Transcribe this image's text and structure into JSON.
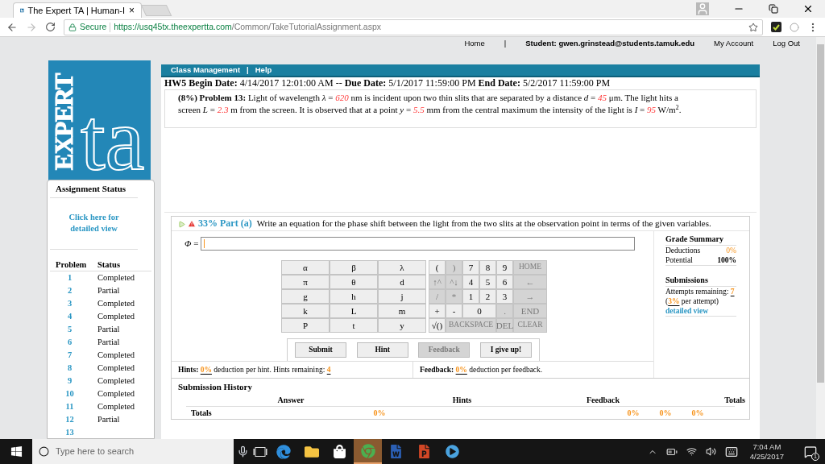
{
  "browser": {
    "tab": {
      "title": "The Expert TA | Human-I",
      "close": "×"
    },
    "address": {
      "secure": "Secure",
      "url_host": "https://usq45tx.theexpertta.com",
      "url_path": "/Common/TakeTutorialAssignment.aspx"
    }
  },
  "top_nav": [
    {
      "kind": "link",
      "text": "Home"
    },
    {
      "kind": "separator",
      "text": "|"
    },
    {
      "kind": "user",
      "text": "Student: gwen.grinstead@students.tamuk.edu"
    },
    {
      "kind": "link",
      "text": "My Account"
    },
    {
      "kind": "link",
      "text": "Log Out"
    }
  ],
  "logo": {
    "word": "EXPERT",
    "mark": "ta"
  },
  "assignment_status": {
    "title": "Assignment Status",
    "detail_link": "Click here for detailed view",
    "columns": [
      "Problem",
      "Status"
    ],
    "rows": [
      {
        "problem": "1",
        "status": "Completed"
      },
      {
        "problem": "2",
        "status": "Partial"
      },
      {
        "problem": "3",
        "status": "Completed"
      },
      {
        "problem": "4",
        "status": "Completed"
      },
      {
        "problem": "5",
        "status": "Partial"
      },
      {
        "problem": "6",
        "status": "Partial"
      },
      {
        "problem": "7",
        "status": "Completed"
      },
      {
        "problem": "8",
        "status": "Completed"
      },
      {
        "problem": "9",
        "status": "Completed"
      },
      {
        "problem": "10",
        "status": "Completed"
      },
      {
        "problem": "11",
        "status": "Completed"
      },
      {
        "problem": "12",
        "status": "Partial"
      },
      {
        "problem": "13"
      }
    ]
  },
  "menu_bar": {
    "items": [
      "Class Management",
      "Help"
    ],
    "separator": "|"
  },
  "dates": "**HW5 Begin Date:** 4/14/2017 12:01:00 AM -- **Due Date:** 5/1/2017 11:59:00 PM **End Date:** 5/2/2017 11:59:00 PM",
  "problem": [
    {
      "kind": "plain",
      "text": "**(8%) Problem 13:** Light of wavelength *λ* = "
    },
    {
      "kind": "value",
      "text": "620"
    },
    {
      "kind": "plain",
      "text": " nm is incident upon two thin slits that are separated by a distance *d* = "
    },
    {
      "kind": "value",
      "text": "45"
    },
    {
      "kind": "plain",
      "text": " μm. The light hits a screen *L* = "
    },
    {
      "kind": "value",
      "text": "2.3"
    },
    {
      "kind": "plain",
      "text": " m from the screen. It is observed that at a point *y* = "
    },
    {
      "kind": "value",
      "text": "5.5"
    },
    {
      "kind": "plain",
      "text": " mm from the central maximum the intensity of the light is *I* = "
    },
    {
      "kind": "value",
      "text": "95"
    },
    {
      "kind": "plain",
      "text": " W/m$^{2}$."
    }
  ],
  "part": {
    "label": "33% Part (a)",
    "prompt": "Write an equation for the phase shift between the light from the two slits at the observation point in terms of the given variables.",
    "answer_label": "*Φ* ="
  },
  "keypad": {
    "letters": [
      [
        "α",
        "β",
        "λ"
      ],
      [
        "π",
        "θ",
        "d"
      ],
      [
        "g",
        "h",
        "j"
      ],
      [
        "k",
        "L",
        "m"
      ],
      [
        "P",
        "t",
        "y"
      ]
    ],
    "controls": [
      {
        "label": "(",
        "disabled": false
      },
      {
        "label": ")",
        "disabled": true
      },
      {
        "label": "7",
        "disabled": false
      },
      {
        "label": "8",
        "disabled": false
      },
      {
        "label": "9",
        "disabled": false
      },
      {
        "label": "HOME",
        "disabled": true
      },
      {
        "label": "↑^",
        "disabled": true
      },
      {
        "label": "^↓",
        "disabled": true
      },
      {
        "label": "4",
        "disabled": false
      },
      {
        "label": "5",
        "disabled": false
      },
      {
        "label": "6",
        "disabled": false
      },
      {
        "label": "←",
        "disabled": true
      },
      {
        "label": "/",
        "disabled": true
      },
      {
        "label": "*",
        "disabled": true
      },
      {
        "label": "1",
        "disabled": false
      },
      {
        "label": "2",
        "disabled": false
      },
      {
        "label": "3",
        "disabled": false
      },
      {
        "label": "→",
        "disabled": true
      },
      {
        "label": "+",
        "disabled": false
      },
      {
        "label": "-",
        "disabled": false
      },
      {
        "label": "0",
        "disabled": false
      },
      {
        "label": ".",
        "disabled": true
      },
      {
        "label": "END",
        "disabled": true
      },
      {
        "label": "√()",
        "disabled": false
      },
      {
        "label": "BACKSPACE",
        "disabled": true
      },
      {
        "label": "DEL",
        "disabled": true
      },
      {
        "label": "CLEAR",
        "disabled": true
      }
    ]
  },
  "buttons": [
    {
      "label": "Submit",
      "disabled": false
    },
    {
      "label": "Hint",
      "disabled": false
    },
    {
      "label": "Feedback",
      "disabled": true
    },
    {
      "label": "I give up!",
      "disabled": false
    }
  ],
  "hints": [
    {
      "kind": "bold",
      "text": "Hints: "
    },
    {
      "kind": "value",
      "text": "0%"
    },
    {
      "kind": "plain",
      "text": " deduction per hint. Hints remaining: "
    },
    {
      "kind": "value",
      "text": "4"
    }
  ],
  "feedback": [
    {
      "kind": "bold",
      "text": "Feedback: "
    },
    {
      "kind": "value",
      "text": "0%"
    },
    {
      "kind": "plain",
      "text": " deduction per feedback."
    }
  ],
  "grade_summary": {
    "title": "Grade Summary",
    "rows": [
      {
        "label": "Deductions",
        "value": "0%",
        "kind": "deduction"
      },
      {
        "label": "Potential",
        "value": "100%",
        "kind": "total"
      }
    ]
  },
  "submissions": {
    "title": "Submissions",
    "attempts": [
      {
        "kind": "plain",
        "text": "Attempts remaining: "
      },
      {
        "kind": "value",
        "text": "7"
      }
    ],
    "per_attempt": [
      {
        "kind": "plain",
        "text": "("
      },
      {
        "kind": "value",
        "text": "3%"
      },
      {
        "kind": "plain",
        "text": " per attempt)"
      }
    ],
    "detail_link": "detailed view"
  },
  "submission_history": {
    "title": "Submission History",
    "columns": [
      "Answer",
      "Hints",
      "Feedback",
      "Totals"
    ],
    "totals_row": [
      "Totals",
      "0%",
      "0%",
      "0%",
      "0%"
    ]
  },
  "taskbar": {
    "search_placeholder": "Type here to search",
    "apps": [
      {
        "kind": "mic",
        "selected": false
      },
      {
        "kind": "task_view",
        "selected": false
      },
      {
        "kind": "edge",
        "selected": false
      },
      {
        "kind": "explorer",
        "selected": false
      },
      {
        "kind": "store",
        "selected": false
      },
      {
        "kind": "chrome",
        "selected": true
      },
      {
        "kind": "word",
        "selected": false
      },
      {
        "kind": "powerpoint",
        "selected": false
      },
      {
        "kind": "media",
        "selected": false
      }
    ],
    "time": "7:04 AM",
    "date": "4/25/2017",
    "notifications": "1"
  }
}
